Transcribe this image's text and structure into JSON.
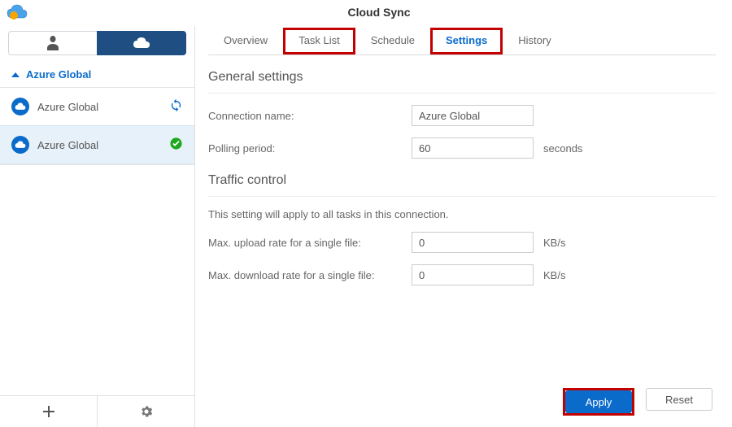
{
  "app": {
    "title": "Cloud Sync"
  },
  "sidebar": {
    "group": "Azure Global",
    "items": [
      {
        "label": "Azure Global",
        "status": "syncing"
      },
      {
        "label": "Azure Global",
        "status": "ok",
        "selected": true
      }
    ]
  },
  "tabs": [
    "Overview",
    "Task List",
    "Schedule",
    "Settings",
    "History"
  ],
  "settings": {
    "general": {
      "title": "General settings",
      "connection_name_label": "Connection name:",
      "connection_name_value": "Azure Global",
      "polling_period_label": "Polling period:",
      "polling_period_value": "60",
      "polling_period_unit": "seconds"
    },
    "traffic": {
      "title": "Traffic control",
      "note": "This setting will apply to all tasks in this connection.",
      "max_upload_label": "Max. upload rate for a single file:",
      "max_upload_value": "0",
      "max_download_label": "Max. download rate for a single file:",
      "max_download_value": "0",
      "unit": "KB/s"
    }
  },
  "footer": {
    "apply": "Apply",
    "reset": "Reset"
  }
}
